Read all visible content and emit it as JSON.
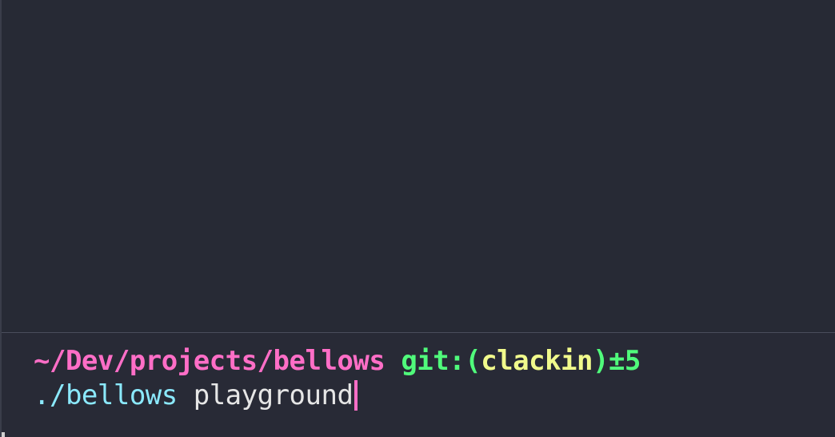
{
  "prompt": {
    "path": "~/Dev/projects/bellows",
    "git_prefix": "git:(",
    "branch": "clackin",
    "git_suffix": ")±5"
  },
  "command": {
    "executable": "./bellows",
    "args": "playground"
  },
  "colors": {
    "background": "#282a36",
    "path": "#ff6ec7",
    "git": "#50fa7b",
    "branch": "#f1fa8c",
    "executable": "#8be9fd",
    "args": "#e6e6e6",
    "cursor": "#ff6ec7"
  }
}
